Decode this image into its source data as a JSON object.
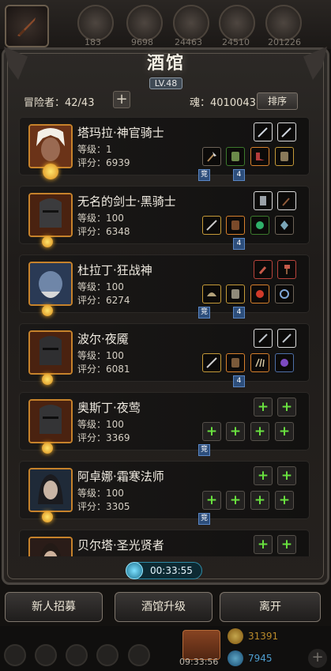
{
  "resources": [
    "183",
    "9698",
    "24463",
    "24510",
    "201226"
  ],
  "header": {
    "title": "酒馆",
    "level": "LV.48"
  },
  "stats": {
    "adventurers": "冒险者：42/43",
    "add": "+",
    "souls": "魂：4010043",
    "sort": "排序"
  },
  "heroes": [
    {
      "name": "塔玛拉·神官骑士",
      "level": "等级：1",
      "score": "评分：6939",
      "tags": [
        "竞",
        "4"
      ]
    },
    {
      "name": "无名的剑士·黑骑士",
      "level": "等级：100",
      "score": "评分：6348",
      "tags": [
        "4"
      ]
    },
    {
      "name": "杜拉丁·狂战神",
      "level": "等级：100",
      "score": "评分：6274",
      "tags": [
        "竞",
        "4"
      ]
    },
    {
      "name": "波尔·夜魇",
      "level": "等级：100",
      "score": "评分：6081",
      "tags": [
        "4"
      ]
    },
    {
      "name": "奥斯丁·夜莺",
      "level": "等级：100",
      "score": "评分：3369",
      "tags": [
        "竞"
      ]
    },
    {
      "name": "阿卓娜·霜寒法师",
      "level": "等级：100",
      "score": "评分：3305",
      "tags": [
        "竞"
      ]
    },
    {
      "name": "贝尔塔·圣光贤者",
      "level": "",
      "score": "",
      "tags": []
    }
  ],
  "add_symbol": "+",
  "timer": "00:33:55",
  "buttons": {
    "recruit": "新人招募",
    "upgrade": "酒馆升级",
    "leave": "离开"
  },
  "dock": {
    "chest_time": "09:33:56",
    "gold": "31391",
    "gems": "7945",
    "plus": "+"
  },
  "colors": {
    "accent_gold": "#c6822b",
    "add_green": "#69e13f",
    "tag_blue": "#2d4e7b"
  }
}
